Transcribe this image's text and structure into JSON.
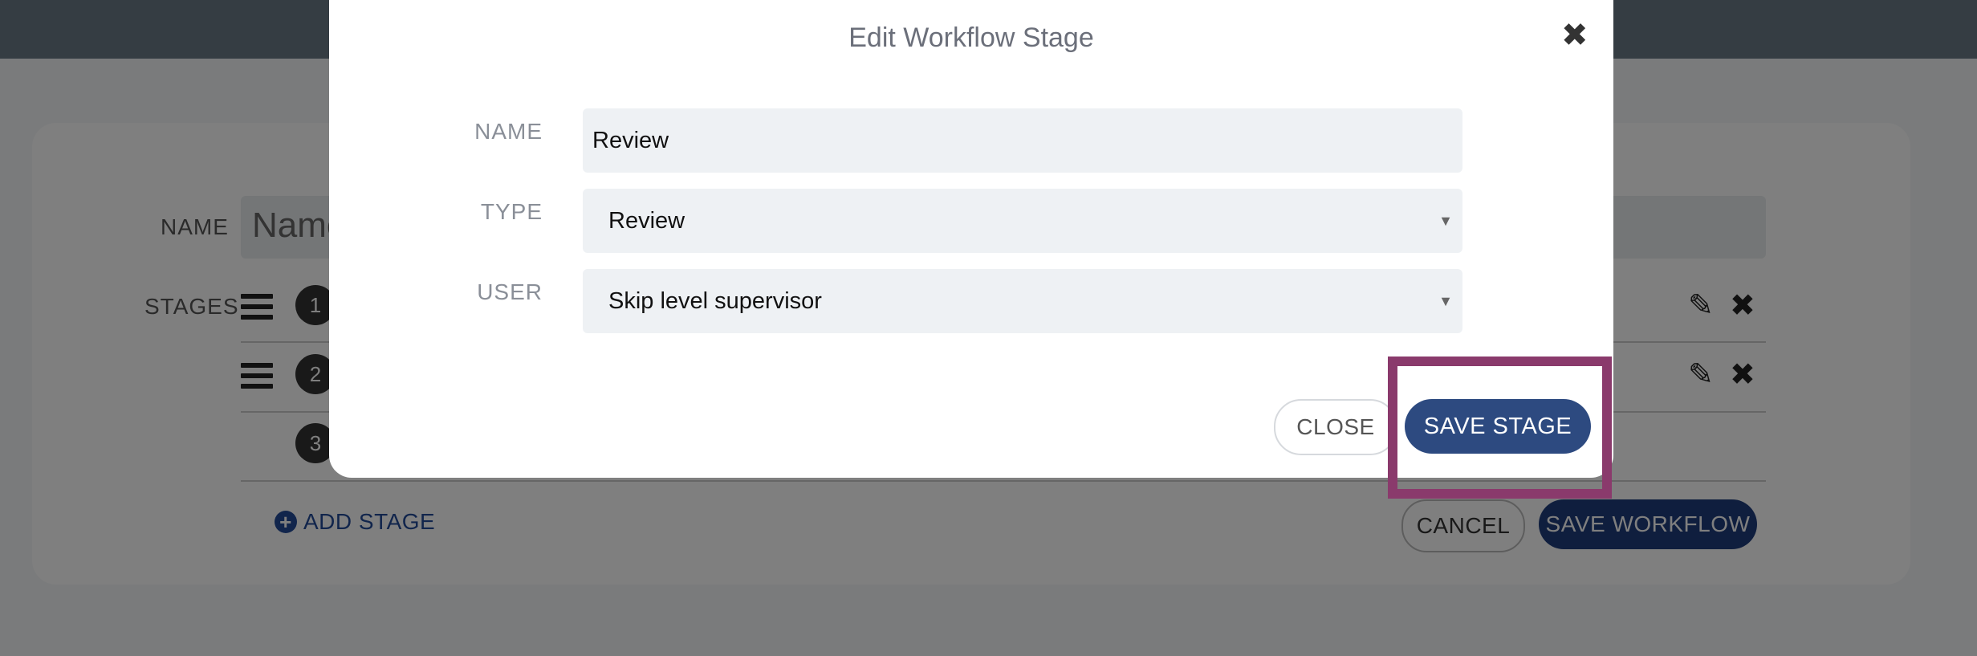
{
  "background": {
    "name_label": "NAME",
    "name_placeholder": "Name",
    "stages_label": "STAGES",
    "stages": [
      {
        "number": "1"
      },
      {
        "number": "2"
      },
      {
        "number": "3"
      }
    ],
    "add_stage_label": "ADD STAGE",
    "cancel_label": "CANCEL",
    "save_workflow_label": "SAVE WORKFLOW"
  },
  "modal": {
    "title": "Edit Workflow Stage",
    "close_icon": "✖",
    "fields": {
      "name": {
        "label": "NAME",
        "value": "Review"
      },
      "type": {
        "label": "TYPE",
        "value": "Review"
      },
      "user": {
        "label": "USER",
        "value": "Skip level supervisor"
      }
    },
    "close_label": "CLOSE",
    "save_stage_label": "SAVE STAGE"
  },
  "colors": {
    "primary": "#2d4a80",
    "highlight": "#8a3a6c"
  },
  "icons": {
    "edit": "✎",
    "delete": "✖",
    "caret": "▼"
  }
}
